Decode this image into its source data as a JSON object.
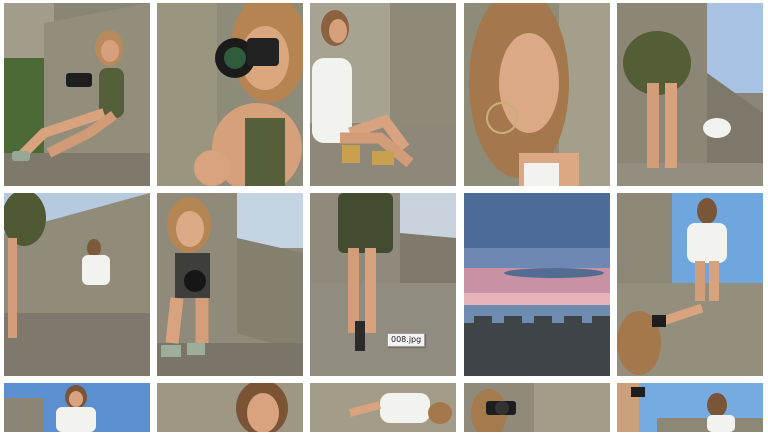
{
  "gallery": {
    "tooltip": "008.jpg",
    "palette": {
      "stone": "#9c9585",
      "stone_dark": "#6e685b",
      "sky_day": "#7fb0e6",
      "sky_dusk": "#d79aa2",
      "sea": "#5d7ea3",
      "skin": "#d9a37f",
      "hair": "#a8774a",
      "dress_green": "#4e5a32",
      "white_cloth": "#f2f2ee"
    }
  }
}
